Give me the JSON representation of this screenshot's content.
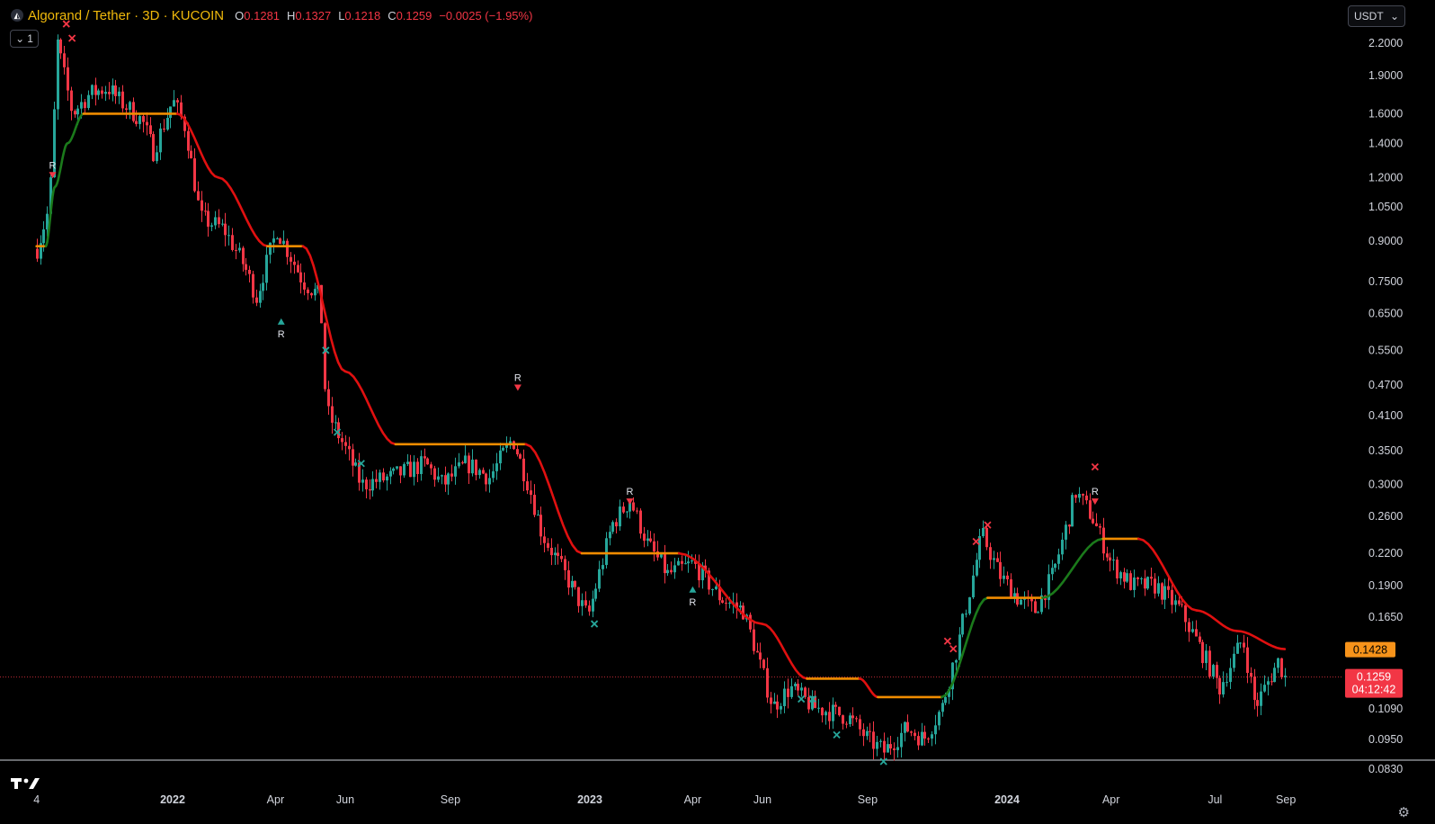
{
  "header": {
    "symbol_title": "Algorand / Tether · 3D · KUCOIN",
    "open_label": "O",
    "open_value": "0.1281",
    "high_label": "H",
    "high_value": "0.1327",
    "low_label": "L",
    "low_value": "0.1218",
    "close_label": "C",
    "close_value": "0.1259",
    "change": "−0.0025 (−1.95%)",
    "logo_icon": "algorand-logo-icon"
  },
  "interval_badge": {
    "icon": "chevron-down-icon",
    "label": "1"
  },
  "currency_selector": {
    "value": "USDT",
    "icon": "chevron-down-icon"
  },
  "colors": {
    "up": "#26a69a",
    "down": "#f23645",
    "trail_up": "#1b7a1b",
    "trail_down": "#e01010",
    "trail_flat": "#f08c00",
    "price_tag": "#f23645",
    "trail_tag": "#f7931a"
  },
  "chart_data": {
    "type": "candlestick",
    "scale": "log",
    "ylim": [
      0.075,
      2.45
    ],
    "y_ticks": [
      "2.2000",
      "1.9000",
      "1.6000",
      "1.4000",
      "1.2000",
      "1.0500",
      "0.9000",
      "0.7500",
      "0.6500",
      "0.5500",
      "0.4700",
      "0.4100",
      "0.3500",
      "0.3000",
      "0.2600",
      "0.2200",
      "0.1900",
      "0.1650",
      "0.1428",
      "0.1259",
      "0.1090",
      "0.0950",
      "0.0830"
    ],
    "x_ticks": [
      "4",
      "2022",
      "Apr",
      "Jun",
      "Sep",
      "2023",
      "Apr",
      "Jun",
      "Sep",
      "2024",
      "Apr",
      "Jul",
      "Sep"
    ],
    "last_price": {
      "value": "0.1259",
      "countdown": "04:12:42"
    },
    "trail_value": "0.1428",
    "price_path": [
      [
        "2021-09-04",
        0.87
      ],
      [
        "2021-09-15",
        1.05
      ],
      [
        "2021-09-22",
        2.2
      ],
      [
        "2021-10-05",
        1.6
      ],
      [
        "2021-10-20",
        1.75
      ],
      [
        "2021-11-05",
        1.8
      ],
      [
        "2021-11-15",
        1.7
      ],
      [
        "2021-12-05",
        1.55
      ],
      [
        "2021-12-15",
        1.35
      ],
      [
        "2022-01-01",
        1.7
      ],
      [
        "2022-01-12",
        1.5
      ],
      [
        "2022-01-25",
        1.0
      ],
      [
        "2022-02-15",
        0.95
      ],
      [
        "2022-03-05",
        0.8
      ],
      [
        "2022-03-15",
        0.7
      ],
      [
        "2022-04-02",
        0.95
      ],
      [
        "2022-04-25",
        0.75
      ],
      [
        "2022-05-10",
        0.7
      ],
      [
        "2022-05-15",
        0.42
      ],
      [
        "2022-05-30",
        0.36
      ],
      [
        "2022-06-15",
        0.3
      ],
      [
        "2022-07-10",
        0.31
      ],
      [
        "2022-08-10",
        0.33
      ],
      [
        "2022-08-25",
        0.3
      ],
      [
        "2022-09-15",
        0.33
      ],
      [
        "2022-10-05",
        0.31
      ],
      [
        "2022-10-25",
        0.37
      ],
      [
        "2022-11-08",
        0.3
      ],
      [
        "2022-11-20",
        0.24
      ],
      [
        "2022-12-10",
        0.2
      ],
      [
        "2022-12-30",
        0.165
      ],
      [
        "2023-01-20",
        0.25
      ],
      [
        "2023-02-05",
        0.28
      ],
      [
        "2023-02-20",
        0.23
      ],
      [
        "2023-03-10",
        0.2
      ],
      [
        "2023-04-01",
        0.21
      ],
      [
        "2023-04-25",
        0.18
      ],
      [
        "2023-05-15",
        0.17
      ],
      [
        "2023-06-10",
        0.11
      ],
      [
        "2023-06-25",
        0.12
      ],
      [
        "2023-07-15",
        0.11
      ],
      [
        "2023-08-15",
        0.105
      ],
      [
        "2023-09-01",
        0.095
      ],
      [
        "2023-09-15",
        0.09
      ],
      [
        "2023-10-05",
        0.1
      ],
      [
        "2023-10-20",
        0.095
      ],
      [
        "2023-11-05",
        0.11
      ],
      [
        "2023-11-20",
        0.15
      ],
      [
        "2023-12-10",
        0.24
      ],
      [
        "2023-12-25",
        0.2
      ],
      [
        "2024-01-10",
        0.18
      ],
      [
        "2024-01-25",
        0.17
      ],
      [
        "2024-02-10",
        0.2
      ],
      [
        "2024-03-01",
        0.29
      ],
      [
        "2024-03-15",
        0.26
      ],
      [
        "2024-04-01",
        0.21
      ],
      [
        "2024-04-20",
        0.19
      ],
      [
        "2024-05-10",
        0.19
      ],
      [
        "2024-06-01",
        0.17
      ],
      [
        "2024-06-20",
        0.14
      ],
      [
        "2024-07-05",
        0.12
      ],
      [
        "2024-07-25",
        0.15
      ],
      [
        "2024-08-05",
        0.11
      ],
      [
        "2024-08-25",
        0.135
      ],
      [
        "2024-08-31",
        0.1259
      ]
    ],
    "trail_path": [
      [
        "2021-09-04",
        0.88,
        "flat"
      ],
      [
        "2021-09-12",
        0.88,
        "up"
      ],
      [
        "2021-09-20",
        1.15,
        "up"
      ],
      [
        "2021-10-01",
        1.4,
        "up"
      ],
      [
        "2021-10-15",
        1.6,
        "flat"
      ],
      [
        "2022-01-05",
        1.6,
        "down"
      ],
      [
        "2022-02-10",
        1.2,
        "down"
      ],
      [
        "2022-03-25",
        0.88,
        "flat"
      ],
      [
        "2022-04-25",
        0.88,
        "down"
      ],
      [
        "2022-06-01",
        0.5,
        "down"
      ],
      [
        "2022-07-15",
        0.36,
        "flat"
      ],
      [
        "2022-11-06",
        0.36,
        "down"
      ],
      [
        "2022-12-25",
        0.22,
        "flat"
      ],
      [
        "2023-03-20",
        0.22,
        "down"
      ],
      [
        "2023-06-01",
        0.16,
        "down"
      ],
      [
        "2023-07-10",
        0.125,
        "flat"
      ],
      [
        "2023-08-25",
        0.125,
        "down"
      ],
      [
        "2023-09-10",
        0.115,
        "flat"
      ],
      [
        "2023-11-05",
        0.115,
        "up"
      ],
      [
        "2023-12-15",
        0.18,
        "flat"
      ],
      [
        "2024-02-01",
        0.18,
        "up"
      ],
      [
        "2024-03-25",
        0.235,
        "flat"
      ],
      [
        "2024-04-25",
        0.235,
        "down"
      ],
      [
        "2024-06-15",
        0.17,
        "down"
      ],
      [
        "2024-07-20",
        0.155,
        "down"
      ],
      [
        "2024-08-31",
        0.1428,
        "down"
      ]
    ],
    "signals": [
      {
        "kind": "R-down",
        "date": "2021-09-18",
        "price": 1.2,
        "text": "R"
      },
      {
        "kind": "R-up",
        "date": "2022-04-06",
        "price": 0.62,
        "text": "R"
      },
      {
        "kind": "R-down",
        "date": "2022-10-30",
        "price": 0.46,
        "text": "R"
      },
      {
        "kind": "R-down",
        "date": "2023-02-05",
        "price": 0.275,
        "text": "R"
      },
      {
        "kind": "R-up",
        "date": "2023-04-01",
        "price": 0.185,
        "text": "R"
      },
      {
        "kind": "R-down",
        "date": "2024-03-18",
        "price": 0.275,
        "text": "R"
      },
      {
        "kind": "x-down",
        "date": "2021-09-30",
        "price": 2.4
      },
      {
        "kind": "x-down",
        "date": "2021-10-05",
        "price": 2.25
      },
      {
        "kind": "x-up",
        "date": "2022-05-15",
        "price": 0.55
      },
      {
        "kind": "x-up",
        "date": "2022-05-25",
        "price": 0.38
      },
      {
        "kind": "x-up",
        "date": "2022-06-15",
        "price": 0.33
      },
      {
        "kind": "x-up",
        "date": "2023-01-05",
        "price": 0.16
      },
      {
        "kind": "x-up",
        "date": "2023-07-05",
        "price": 0.114
      },
      {
        "kind": "x-up",
        "date": "2023-07-15",
        "price": 0.114
      },
      {
        "kind": "x-up",
        "date": "2023-08-05",
        "price": 0.097
      },
      {
        "kind": "x-up",
        "date": "2023-09-15",
        "price": 0.086
      },
      {
        "kind": "x-down",
        "date": "2023-11-10",
        "price": 0.148
      },
      {
        "kind": "x-down",
        "date": "2023-11-15",
        "price": 0.143
      },
      {
        "kind": "x-down",
        "date": "2023-12-05",
        "price": 0.232
      },
      {
        "kind": "x-down",
        "date": "2023-12-15",
        "price": 0.25
      },
      {
        "kind": "x-down",
        "date": "2024-03-18",
        "price": 0.325
      }
    ]
  }
}
